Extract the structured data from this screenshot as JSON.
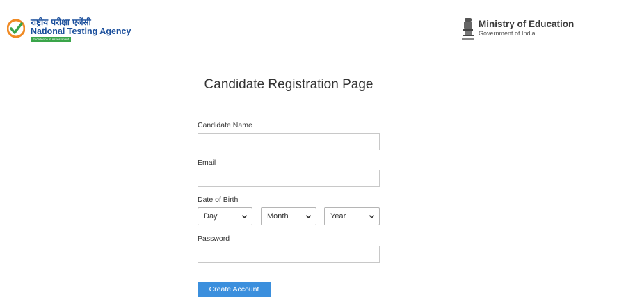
{
  "header": {
    "nta": {
      "hindi_name": "राष्ट्रीय परीक्षा एजेंसी",
      "english_name": "National Testing Agency",
      "tagline": "Excellence in Assessment",
      "icon": "check-swoosh-icon"
    },
    "ministry": {
      "title": "Ministry of Education",
      "subtitle": "Government of India",
      "icon": "national-emblem-icon"
    }
  },
  "form": {
    "title": "Candidate Registration Page",
    "fields": {
      "name": {
        "label": "Candidate Name",
        "value": "",
        "placeholder": ""
      },
      "email": {
        "label": "Email",
        "value": "",
        "placeholder": ""
      },
      "dob": {
        "label": "Date of Birth",
        "day": "Day",
        "month": "Month",
        "year": "Year"
      },
      "password": {
        "label": "Password",
        "value": "",
        "placeholder": ""
      }
    },
    "submit_label": "Create Account"
  },
  "colors": {
    "brand_blue": "#1b4f9c",
    "brand_green": "#3aa54a",
    "brand_orange": "#f08a24",
    "button_blue": "#3b8fdd"
  }
}
